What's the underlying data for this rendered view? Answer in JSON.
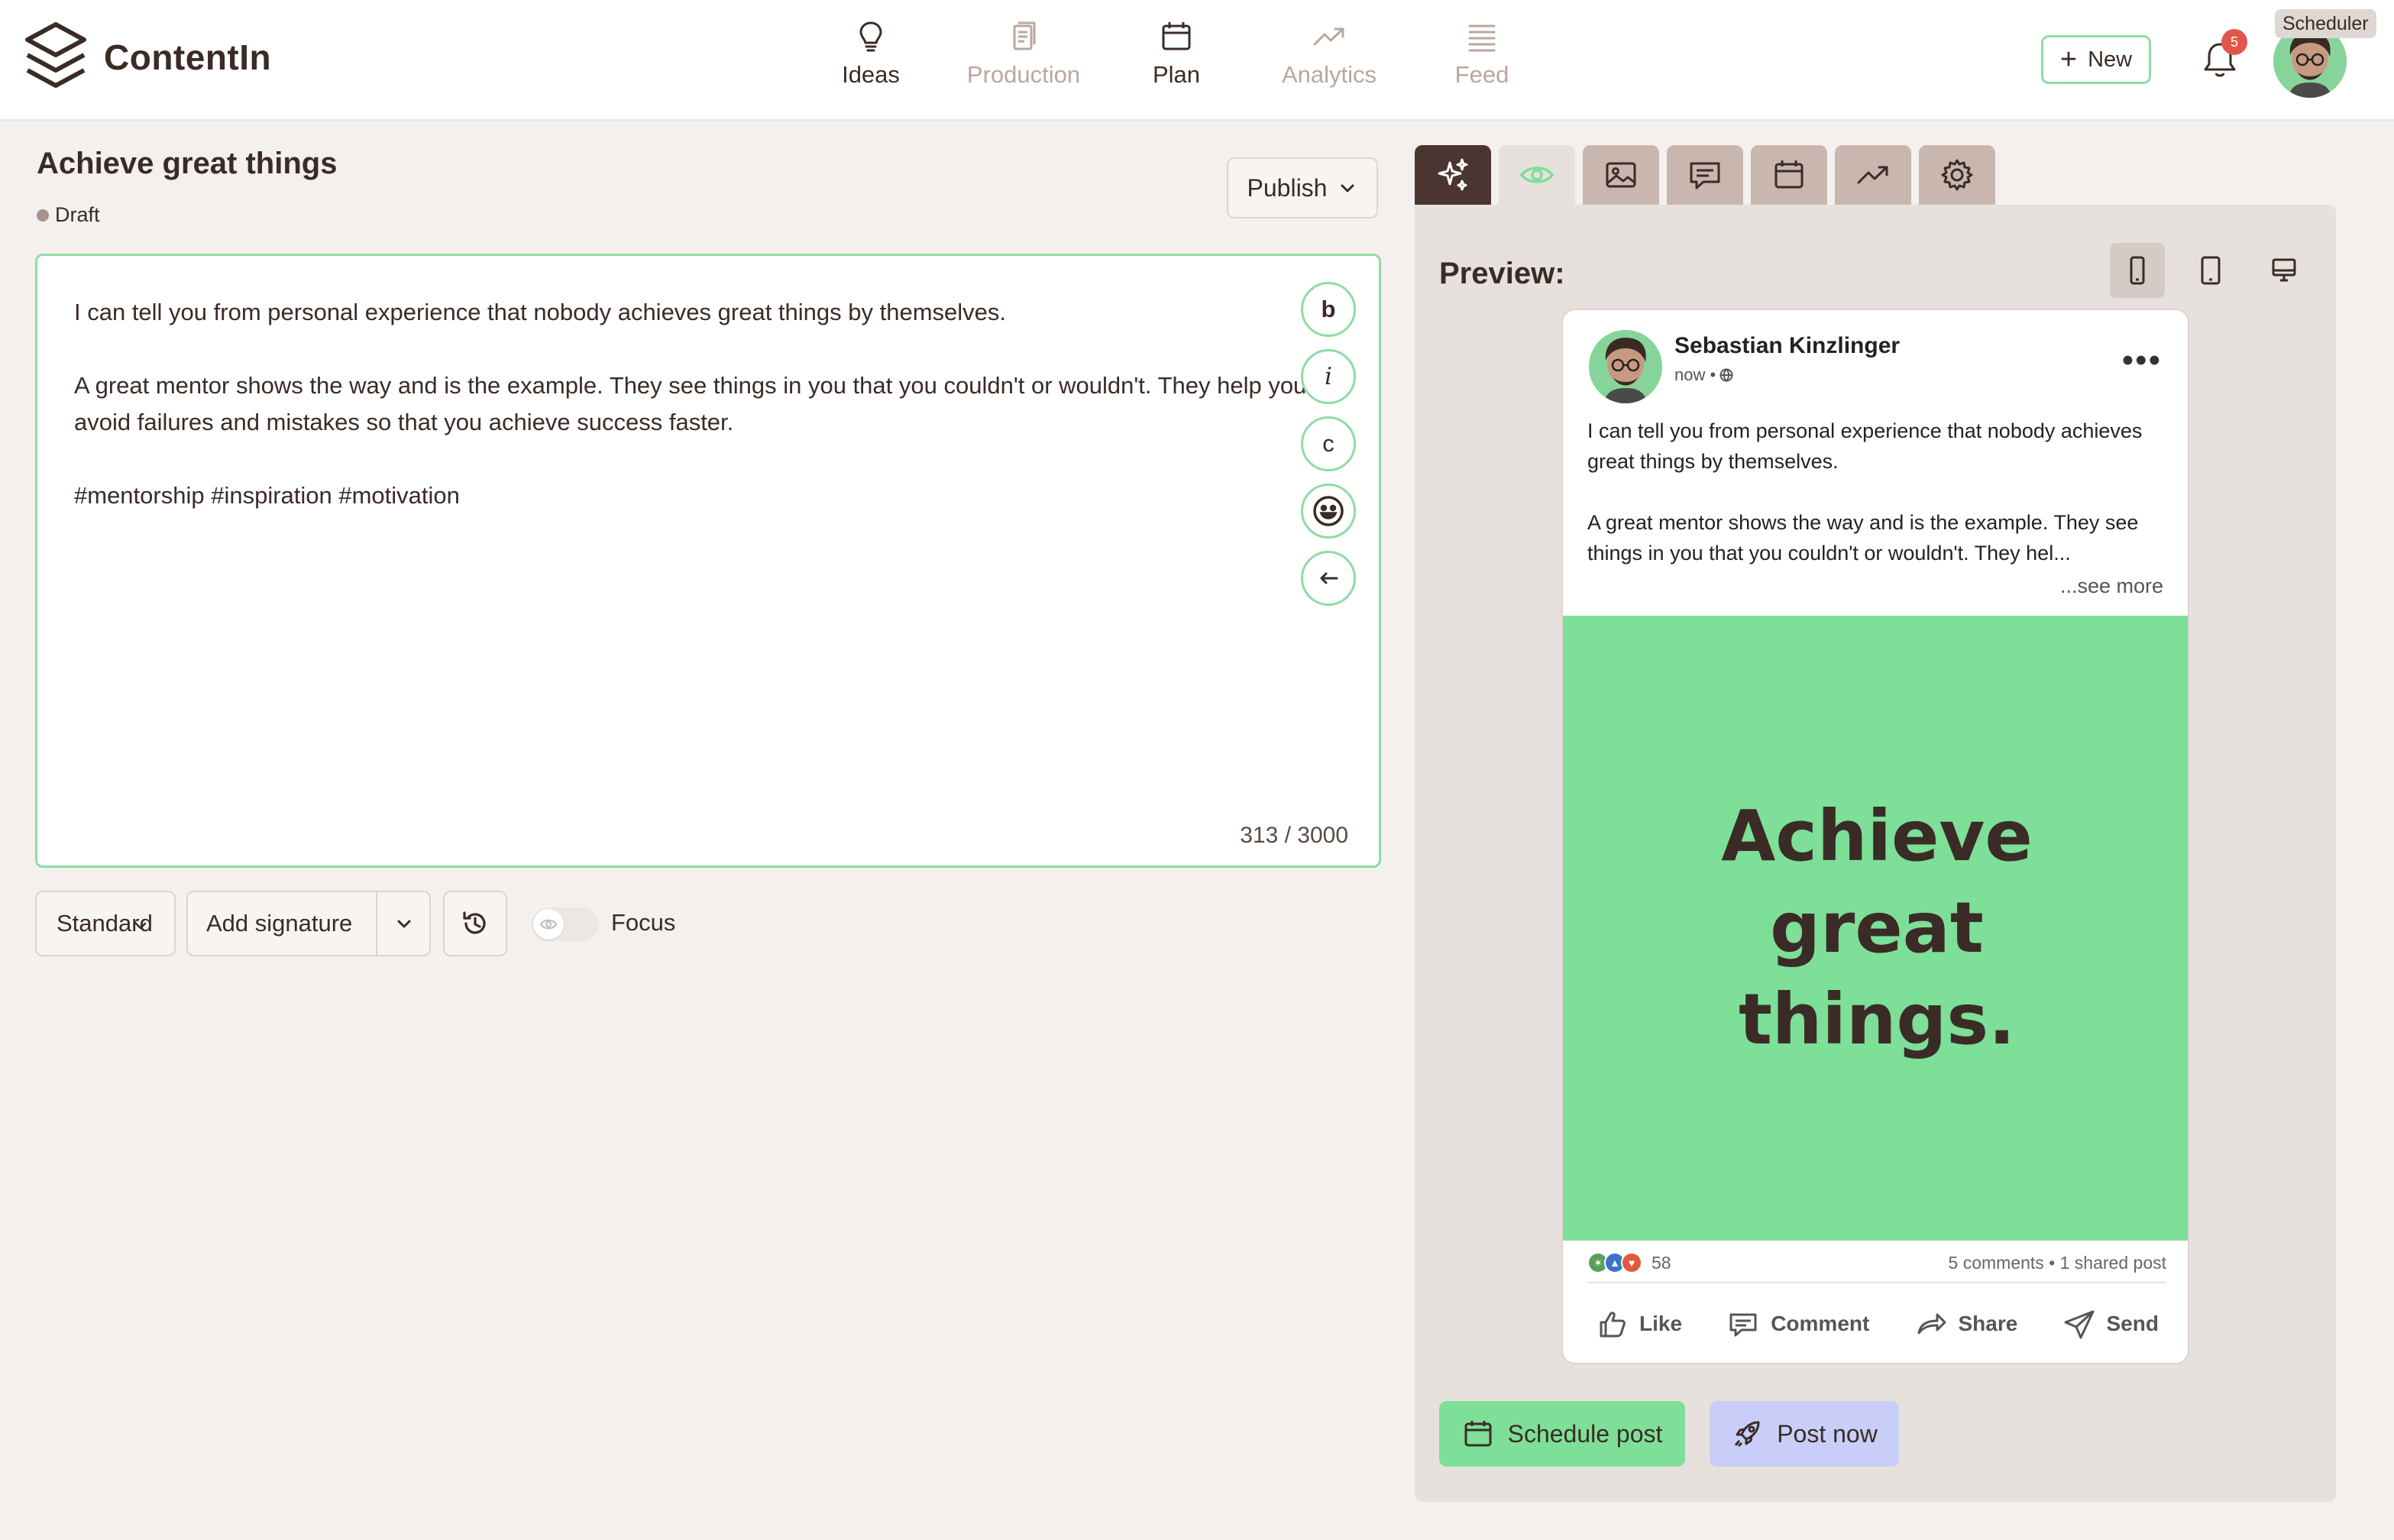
{
  "app": {
    "name": "ContentIn"
  },
  "nav": {
    "items": [
      {
        "label": "Ideas",
        "icon": "lightbulb-icon",
        "state": "active"
      },
      {
        "label": "Production",
        "icon": "documents-icon",
        "state": "dim"
      },
      {
        "label": "Plan",
        "icon": "calendar-icon",
        "state": "active"
      },
      {
        "label": "Analytics",
        "icon": "trend-icon",
        "state": "dim"
      },
      {
        "label": "Feed",
        "icon": "feed-icon",
        "state": "dim"
      }
    ]
  },
  "header": {
    "new_label": "New",
    "notification_count": "5",
    "user_role_tag": "Scheduler"
  },
  "post": {
    "title": "Achieve great things",
    "status": "Draft",
    "publish_label": "Publish",
    "paragraphs": [
      "I can tell you from personal experience that nobody achieves great things by themselves.",
      "A great mentor shows the way and is the example. They see things in you that you couldn't or wouldn't. They help you avoid failures and mistakes so that you achieve success faster.",
      "#mentorship #inspiration #motivation"
    ],
    "char_count": "313 / 3000",
    "format_buttons": [
      "b",
      "i",
      "c"
    ]
  },
  "toolbar": {
    "style_value": "Standard",
    "signature_label": "Add signature",
    "focus_label": "Focus"
  },
  "preview": {
    "title": "Preview:",
    "author": "Sebastian Kinzlinger",
    "time": "now •",
    "text_p1": "I can tell you from personal experience that nobody achieves great things by themselves.",
    "text_p2": "A great mentor shows the way and is the example. They see things in you that you couldn't or wouldn't. They hel...",
    "see_more": "...see more",
    "image_text": "Achieve great things.",
    "reactions_count": "58",
    "comments_shares": "5 comments • 1 shared post",
    "actions": {
      "like": "Like",
      "comment": "Comment",
      "share": "Share",
      "send": "Send"
    }
  },
  "actions": {
    "schedule_label": "Schedule post",
    "post_now_label": "Post now"
  },
  "colors": {
    "accent_green": "#8fdca4",
    "image_green": "#7ddf98",
    "post_now_blue": "#c8cef8",
    "brand_dark": "#3b2b26",
    "badge_red": "#e2574c"
  }
}
